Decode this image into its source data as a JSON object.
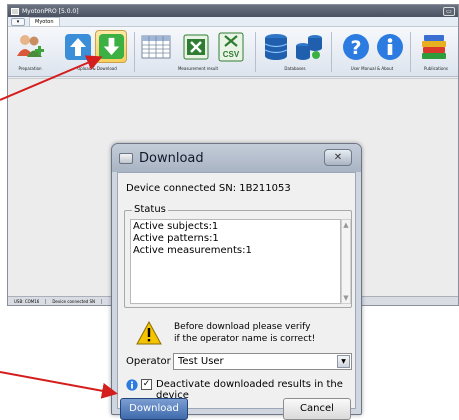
{
  "app": {
    "title": "MyotonPRO [5.0.0]",
    "menu_tab": "Myoton"
  },
  "ribbon": {
    "groups": [
      {
        "label": "Preparation"
      },
      {
        "label": "Upload & Download"
      },
      {
        "label": "Measurement result"
      },
      {
        "label": "Databases"
      },
      {
        "label": "User Manual & About"
      },
      {
        "label": "Publications"
      }
    ]
  },
  "statusbar": {
    "usb": "USB: COM16",
    "device": "Device connected SN"
  },
  "dialog": {
    "title": "Download",
    "device_line": "Device connected SN: 1B211053",
    "status_legend": "Status",
    "status_lines": [
      "Active subjects:1",
      "Active patterns:1",
      "Active measurements:1"
    ],
    "warning_line1": "Before download please verify",
    "warning_line2": "if the operator name is correct!",
    "operator_label": "Operator",
    "operator_value": "Test User",
    "deactivate_label": "Deactivate downloaded results in the device",
    "deactivate_checked": true,
    "download_label": "Download",
    "cancel_label": "Cancel"
  },
  "colors": {
    "arrow": "#d41d1d",
    "highlight": "#f7cf5c",
    "download_button": "#3e6aab"
  },
  "icons": {
    "preparation": "people-plus-icon",
    "upload": "upload-arrow-icon",
    "download": "download-arrow-icon",
    "table": "table-icon",
    "excel": "excel-icon",
    "csv": "csv-icon",
    "database": "database-icon",
    "database_network": "database-network-icon",
    "help": "help-icon",
    "about": "info-icon",
    "publications": "books-icon",
    "warning": "warning-icon",
    "info": "info-icon"
  }
}
